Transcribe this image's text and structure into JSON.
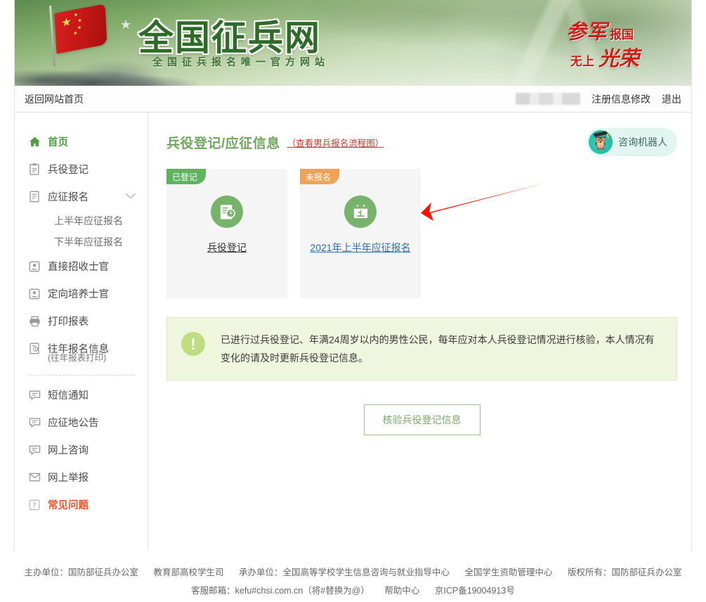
{
  "banner": {
    "title": "全国征兵网",
    "subtitle": "全国征兵报名唯一官方网站",
    "slogan_line1_big": "参军",
    "slogan_line1_small": "报国",
    "slogan_line2_small": "无上",
    "slogan_line2_big": "光荣",
    "flag_icon": "chinese-flag-icon",
    "star_icon": "star-icon"
  },
  "topnav": {
    "home_label": "返回网站首页",
    "username_redacted": "",
    "register_edit_label": "注册信息修改",
    "logout_label": "退出"
  },
  "sidebar": {
    "items": [
      {
        "label": "首页",
        "icon": "home-icon",
        "name": "sidebar-item-home"
      },
      {
        "label": "兵役登记",
        "icon": "clipboard-icon",
        "name": "sidebar-item-military-registration"
      },
      {
        "label": "应征报名",
        "icon": "document-icon",
        "name": "sidebar-item-enlistment-application",
        "chevron": "chevron-down-icon"
      },
      {
        "label": "上半年应征报名",
        "name": "sidebar-subitem-first-half-year"
      },
      {
        "label": "下半年应征报名",
        "name": "sidebar-subitem-second-half-year"
      },
      {
        "label": "直接招收士官",
        "icon": "badge-person-icon",
        "name": "sidebar-item-direct-recruit-nco"
      },
      {
        "label": "定向培养士官",
        "icon": "badge-person-icon",
        "name": "sidebar-item-targeted-training-nco"
      },
      {
        "label": "打印报表",
        "icon": "printer-icon",
        "name": "sidebar-item-print-report"
      },
      {
        "label": "往年报名信息",
        "sublabel": "(往年报表打印)",
        "icon": "history-icon",
        "name": "sidebar-item-past-applications"
      },
      {
        "label": "短信通知",
        "icon": "message-icon",
        "name": "sidebar-item-sms-notice"
      },
      {
        "label": "应征地公告",
        "icon": "message-icon",
        "name": "sidebar-item-local-announcement"
      },
      {
        "label": "网上咨询",
        "icon": "message-icon",
        "name": "sidebar-item-online-consult"
      },
      {
        "label": "网上举报",
        "icon": "envelope-icon",
        "name": "sidebar-item-online-report"
      },
      {
        "label": "常见问题",
        "icon": "question-icon",
        "name": "sidebar-item-faq",
        "active": true
      }
    ]
  },
  "main": {
    "title": "兵役登记/应征信息",
    "flow_link": "（查看男兵报名流程图）",
    "robot": {
      "label": "咨询机器人",
      "icon": "owl-robot-icon"
    },
    "cards": [
      {
        "badge": "已登记",
        "badge_color": "#5fb35c",
        "link": "兵役登记",
        "icon": "document-clock-icon",
        "name": "card-military-registration"
      },
      {
        "badge": "未报名",
        "badge_color": "#f2a254",
        "link": "2021年上半年应征报名",
        "icon": "calendar-icon",
        "name": "card-2021-first-half-enlistment"
      }
    ],
    "annotation": {
      "icon": "red-arrow-icon",
      "color": "#ff1100"
    },
    "alert": {
      "icon": "exclamation-icon",
      "text": "已进行过兵役登记、年满24周岁以内的男性公民，每年应对本人兵役登记情况进行核验，本人情况有变化的请及时更新兵役登记信息。"
    },
    "verify_button": "核验兵役登记信息"
  },
  "footer": {
    "line1": [
      "主办单位：国防部征兵办公室",
      "教育部高校学生司",
      "承办单位：全国高等学校学生信息咨询与就业指导中心",
      "全国学生资助管理中心",
      "版权所有：国防部征兵办公室"
    ],
    "line2": [
      "客服邮箱：kefu#chsi.com.cn（将#替换为@）",
      "帮助中心",
      "京ICP备19004913号"
    ]
  }
}
